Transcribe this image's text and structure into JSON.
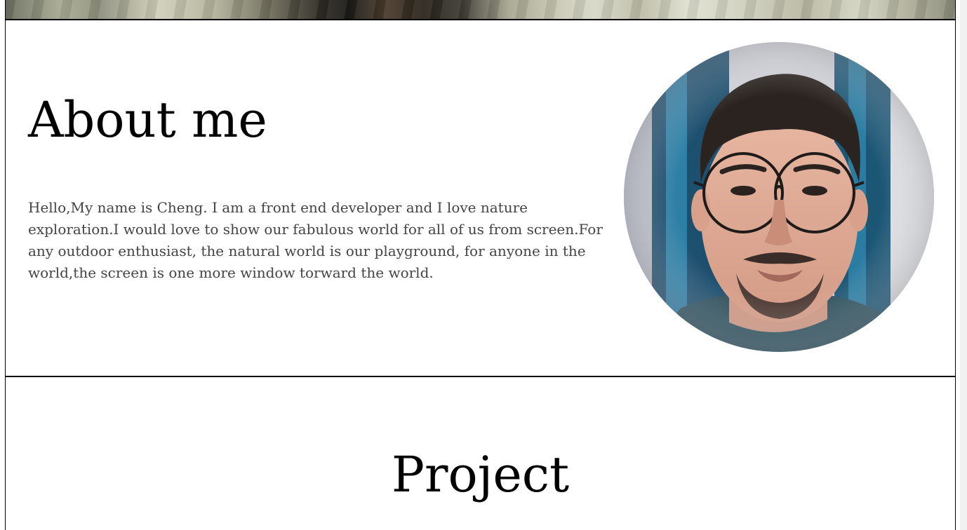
{
  "about": {
    "title": "About me",
    "text": "Hello,My name is Cheng. I am a front end developer and I love nature exploration.I would love to show our fabulous world for all of us from screen.For any outdoor enthusiast, the natural world is our playground, for anyone in the world,the screen is one more window torward the world."
  },
  "project": {
    "title": "Project"
  },
  "colors": {
    "border": "#000000",
    "body_text": "#444444",
    "heading": "#000000",
    "background": "#ffffff"
  }
}
